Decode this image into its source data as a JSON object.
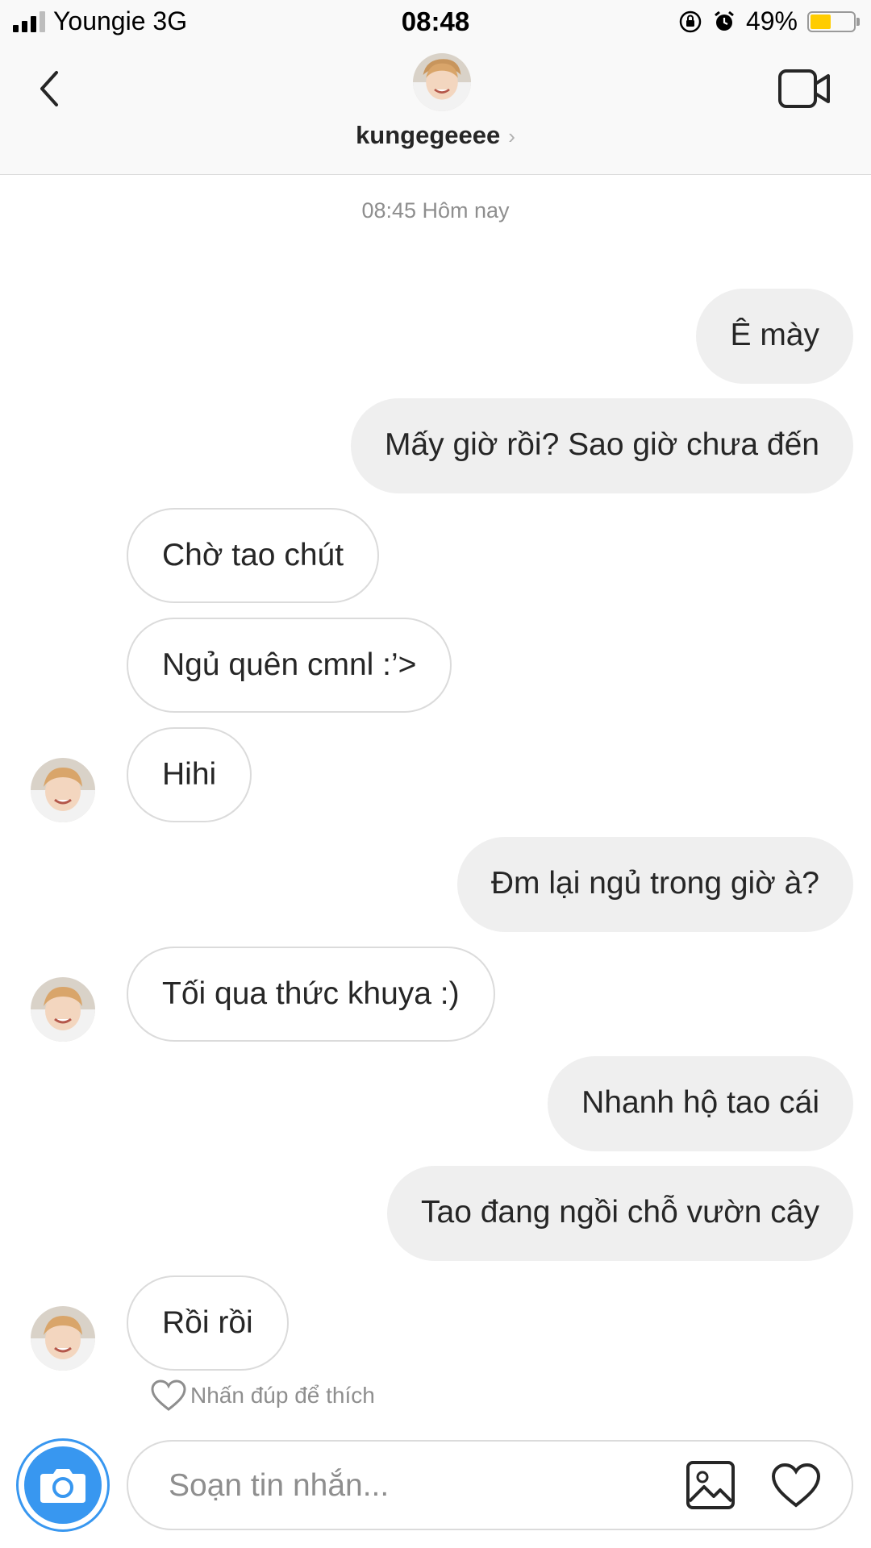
{
  "status_bar": {
    "carrier": "Youngie",
    "network": "3G",
    "time": "08:48",
    "battery_percent": "49%",
    "battery_level": 0.49
  },
  "header": {
    "username": "kungegeeee",
    "chevron": "›"
  },
  "thread": {
    "timestamp": "08:45 Hôm nay",
    "messages": [
      {
        "direction": "out",
        "text": "Ê mày"
      },
      {
        "direction": "out",
        "text": "Mấy giờ rồi? Sao giờ chưa đến"
      },
      {
        "direction": "in",
        "text": "Chờ tao chút"
      },
      {
        "direction": "in",
        "text": "Ngủ quên cmnl :’>"
      },
      {
        "direction": "in",
        "text": "Hihi"
      },
      {
        "direction": "out",
        "text": "Đm lại ngủ trong giờ à?"
      },
      {
        "direction": "in",
        "text": "Tối qua thức khuya :)"
      },
      {
        "direction": "out",
        "text": "Nhanh hộ tao cái"
      },
      {
        "direction": "out",
        "text": "Tao đang ngồi chỗ vườn cây"
      },
      {
        "direction": "in",
        "text": "Rồi rồi"
      }
    ],
    "like_hint": "Nhấn đúp để thích"
  },
  "composer": {
    "placeholder": "Soạn tin nhắn..."
  },
  "icons": {
    "back": "chevron-left-icon",
    "video": "video-camera-icon",
    "camera": "camera-icon",
    "gallery": "image-icon",
    "like": "heart-icon"
  },
  "colors": {
    "accent": "#3897f0",
    "outgoing_bubble": "#efefef",
    "incoming_border": "#dbdbdb",
    "battery": "#ffcc00"
  }
}
